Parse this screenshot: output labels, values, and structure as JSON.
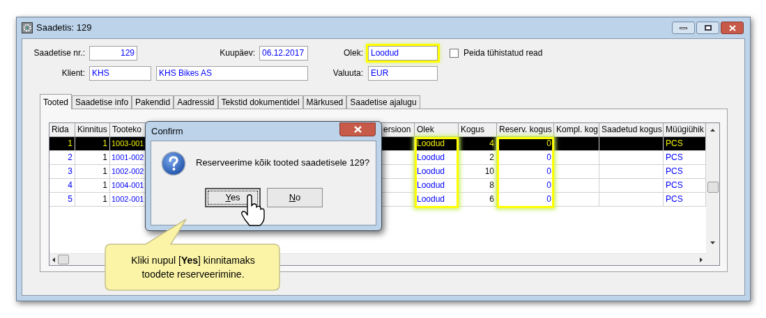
{
  "window": {
    "title": "Saadetis: 129"
  },
  "form": {
    "number": {
      "label": "Saadetise nr.:",
      "value": "129"
    },
    "date": {
      "label": "Kuupäev:",
      "value": "06.12.2017"
    },
    "status": {
      "label": "Olek:",
      "value": "Loodud",
      "highlighted": true
    },
    "hide_cancelled": {
      "label": "Peida tühistatud read",
      "checked": false
    },
    "client": {
      "label": "Klient:",
      "code": "KHS",
      "name": "KHS Bikes AS"
    },
    "currency": {
      "label": "Valuuta:",
      "value": "EUR"
    }
  },
  "tabs": [
    {
      "label": "Tooted",
      "selected": true
    },
    {
      "label": "Saadetise info",
      "selected": false
    },
    {
      "label": "Pakendid",
      "selected": false
    },
    {
      "label": "Aadressid",
      "selected": false
    },
    {
      "label": "Tekstid dokumentidel",
      "selected": false
    },
    {
      "label": "Märkused",
      "selected": false
    },
    {
      "label": "Saadetise ajalugu",
      "selected": false
    }
  ],
  "table": {
    "columns": [
      {
        "label": "Rida",
        "highlighted": false
      },
      {
        "label": "Kinnitus",
        "highlighted": false
      },
      {
        "label": "Tooteko",
        "highlighted": false
      },
      {
        "label": "ersioon",
        "highlighted": false
      },
      {
        "label": "Olek",
        "highlighted": true
      },
      {
        "label": "Kogus",
        "highlighted": false
      },
      {
        "label": "Reserv. kogus",
        "highlighted": true
      },
      {
        "label": "Kompl. kog",
        "highlighted": false
      },
      {
        "label": "Saadetud kogus",
        "highlighted": false
      },
      {
        "label": "Müügiühik",
        "highlighted": false
      }
    ],
    "rows": [
      {
        "selected": true,
        "rida": "1",
        "kinnitus": "1",
        "code": "1003-001",
        "olek": "Loodud",
        "kogus": "4",
        "reserv": "0",
        "unit": "PCS"
      },
      {
        "selected": false,
        "rida": "2",
        "kinnitus": "1",
        "code": "1001-002",
        "olek": "Loodud",
        "kogus": "2",
        "reserv": "0",
        "unit": "PCS"
      },
      {
        "selected": false,
        "rida": "3",
        "kinnitus": "1",
        "code": "1002-002",
        "olek": "Loodud",
        "kogus": "10",
        "reserv": "0",
        "unit": "PCS"
      },
      {
        "selected": false,
        "rida": "4",
        "kinnitus": "1",
        "code": "1004-001",
        "olek": "Loodud",
        "kogus": "8",
        "reserv": "0",
        "unit": "PCS"
      },
      {
        "selected": false,
        "rida": "5",
        "kinnitus": "1",
        "code": "1002-001",
        "olek": "Loodud",
        "kogus": "6",
        "reserv": "0",
        "unit": "PCS"
      }
    ]
  },
  "dialog": {
    "title": "Confirm",
    "message": "Reserveerime kõik tooted saadetisele 129?",
    "buttons": [
      {
        "label": "Yes",
        "focused": true
      },
      {
        "label": "No",
        "focused": false
      }
    ]
  },
  "callout": {
    "text": "Kliki nupul [**Yes**] kinnitamaks toodete reserveerimine."
  }
}
